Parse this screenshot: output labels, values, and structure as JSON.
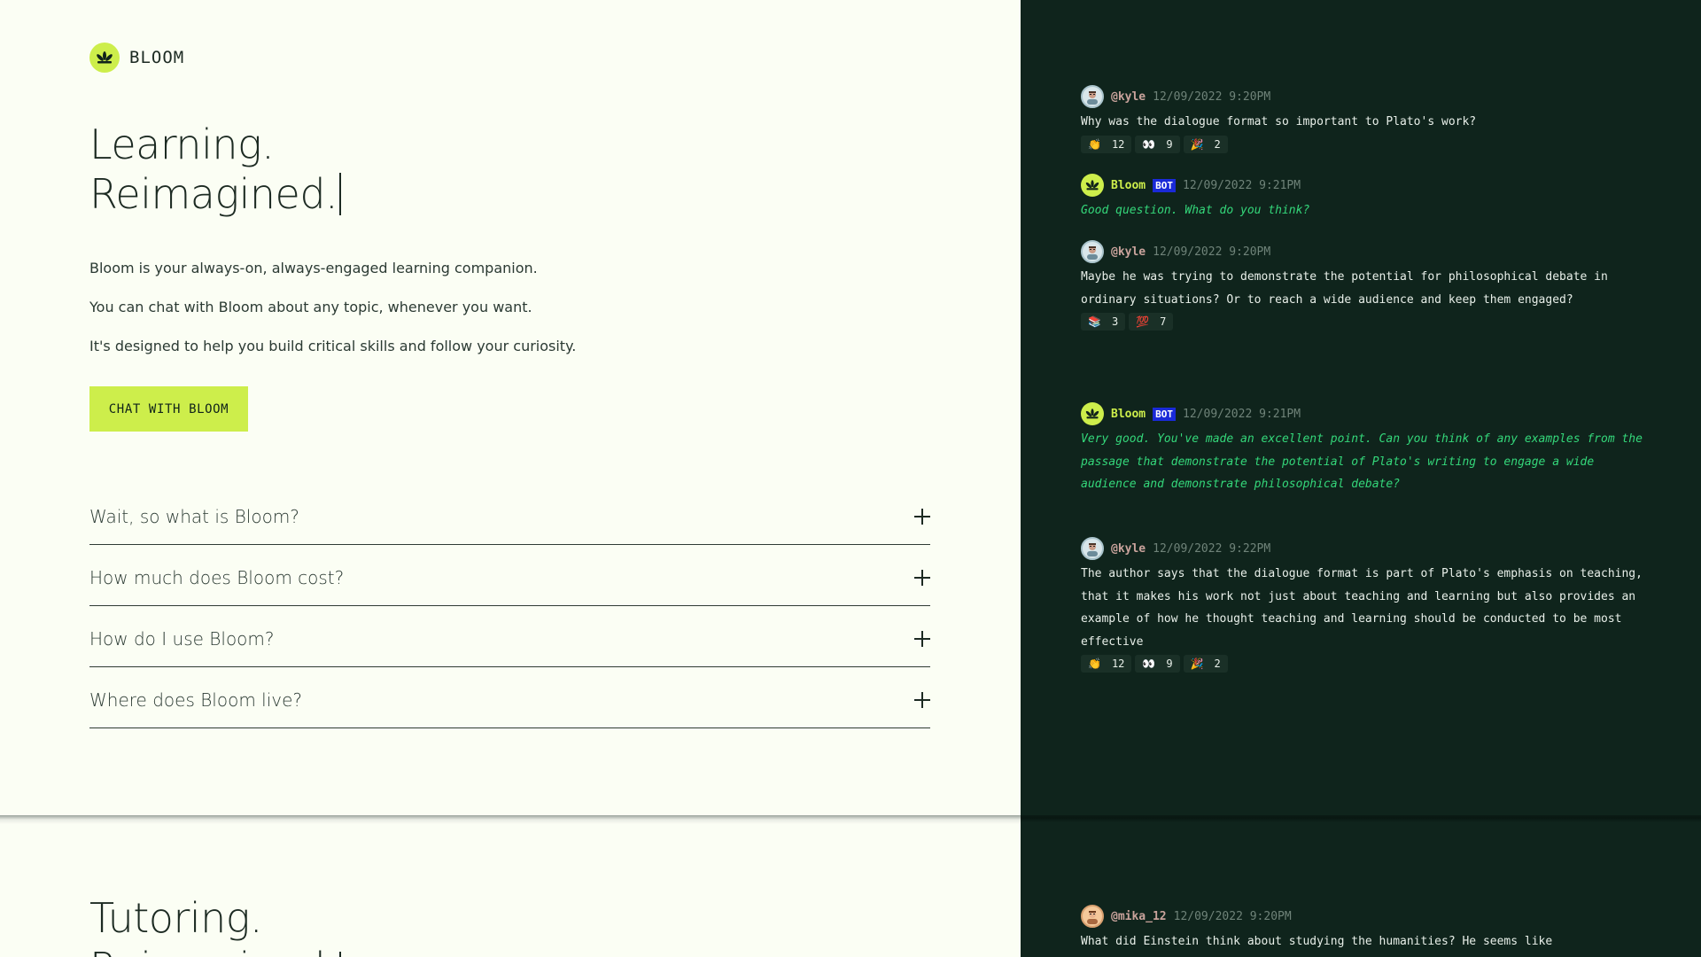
{
  "brand": {
    "name": "BLOOM"
  },
  "hero": {
    "line1": "Learning.",
    "line2": "Reimagined.",
    "paragraphs": [
      "Bloom is your always-on, always-engaged learning companion.",
      "You can chat with Bloom about any topic, whenever you want.",
      "It's designed to help you build critical skills and follow your curiosity."
    ],
    "cta_label": "CHAT WITH BLOOM"
  },
  "faq": [
    {
      "question": "Wait, so what is Bloom?"
    },
    {
      "question": "How much does Bloom cost?"
    },
    {
      "question": "How do I use Bloom?"
    },
    {
      "question": "Where does Bloom live?"
    }
  ],
  "section2": {
    "line1": "Tutoring.",
    "line2": "Reimagined."
  },
  "chat": {
    "bot_badge": "BOT",
    "messages": [
      {
        "author": "@kyle",
        "timestamp": "12/09/2022 9:20PM",
        "text": "Why was the dialogue format so important to Plato's work?",
        "reactions": [
          {
            "emoji": "👏",
            "count": "12"
          },
          {
            "emoji": "👀",
            "count": "9"
          },
          {
            "emoji": "🎉",
            "count": "2"
          }
        ]
      },
      {
        "author": "Bloom",
        "timestamp": "12/09/2022 9:21PM",
        "text": "Good question. What do you think?"
      },
      {
        "author": "@kyle",
        "timestamp": "12/09/2022 9:20PM",
        "text": "Maybe he was trying to demonstrate the potential for philosophical debate in ordinary situations? Or to reach a wide audience and keep them engaged?",
        "reactions": [
          {
            "emoji": "📚",
            "count": "3"
          },
          {
            "emoji": "💯",
            "count": "7"
          }
        ]
      },
      {
        "author": "Bloom",
        "timestamp": "12/09/2022 9:21PM",
        "text": "Very good. You've made an excellent point. Can you think of any examples from the passage that demonstrate the potential of Plato's writing to engage a wide audience and demonstrate philosophical debate?"
      },
      {
        "author": "@kyle",
        "timestamp": "12/09/2022 9:22PM",
        "text": "The author says that the dialogue format is part of Plato's emphasis on teaching, that it makes his work not just about teaching and learning but also provides an example of how he thought teaching and learning should be conducted to be most effective",
        "reactions": [
          {
            "emoji": "👏",
            "count": "12"
          },
          {
            "emoji": "👀",
            "count": "9"
          },
          {
            "emoji": "🎉",
            "count": "2"
          }
        ]
      },
      {
        "author": "@mika_12",
        "timestamp": "12/09/2022 9:20PM",
        "text": "What did Einstein think about studying the humanities? He seems like"
      }
    ]
  }
}
